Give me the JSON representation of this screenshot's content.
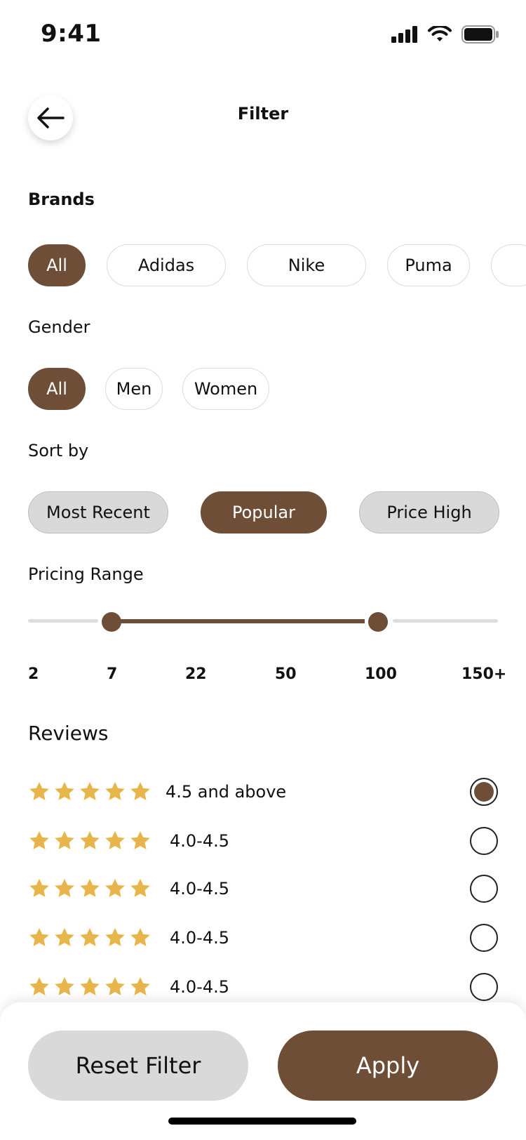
{
  "status_bar": {
    "time": "9:41"
  },
  "header": {
    "title": "Filter"
  },
  "brands": {
    "title": "Brands",
    "chips": [
      {
        "label": "All",
        "active": true
      },
      {
        "label": "Adidas",
        "active": false
      },
      {
        "label": "Nike",
        "active": false
      },
      {
        "label": "Puma",
        "active": false
      },
      {
        "label": "",
        "active": false
      }
    ]
  },
  "gender": {
    "title": "Gender",
    "chips": [
      {
        "label": "All",
        "active": true
      },
      {
        "label": "Men",
        "active": false
      },
      {
        "label": "Women",
        "active": false
      }
    ]
  },
  "sort_by": {
    "title": "Sort by",
    "chips": [
      {
        "label": "Most Recent",
        "active": false
      },
      {
        "label": "Popular",
        "active": true
      },
      {
        "label": "Price High",
        "active": false
      }
    ]
  },
  "pricing_range": {
    "title": "Pricing Range",
    "ticks": [
      "2",
      "7",
      "22",
      "50",
      "100",
      "150+"
    ],
    "selected_min": "7",
    "selected_max": "100"
  },
  "reviews": {
    "title": "Reviews",
    "options": [
      {
        "label": "4.5 and above",
        "stars": 5,
        "selected": true
      },
      {
        "label": "4.0-4.5",
        "stars": 5,
        "selected": false
      },
      {
        "label": "4.0-4.5",
        "stars": 5,
        "selected": false
      },
      {
        "label": "4.0-4.5",
        "stars": 5,
        "selected": false
      },
      {
        "label": "4.0-4.5",
        "stars": 5,
        "selected": false
      }
    ]
  },
  "actions": {
    "reset_label": "Reset Filter",
    "apply_label": "Apply"
  },
  "colors": {
    "accent": "#6e4e36",
    "star": "#e8b54a",
    "chip_gray": "#d9d9d9"
  },
  "icons": [
    "signal-icon",
    "wifi-icon",
    "battery-icon",
    "back-arrow-icon",
    "star-icon"
  ]
}
